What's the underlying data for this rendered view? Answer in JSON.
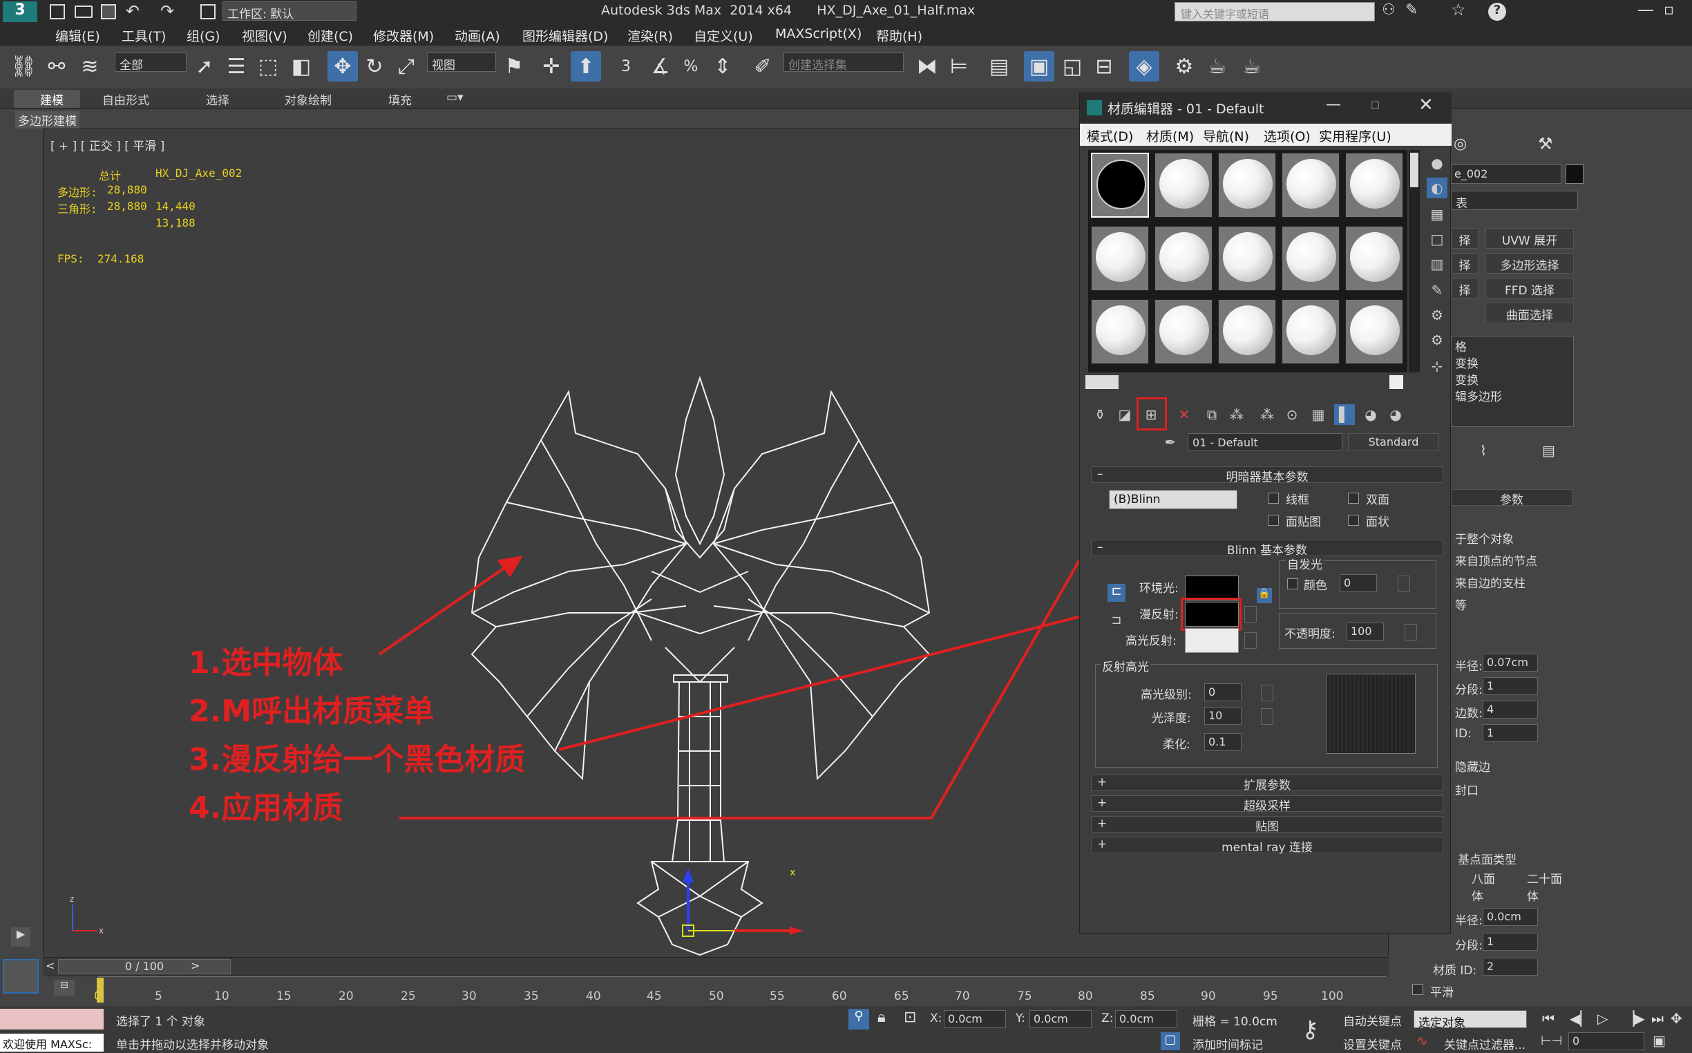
{
  "app": {
    "title": "Autodesk 3ds Max  2014 x64      HX_DJ_Axe_01_Half.max",
    "workspace_label": "工作区: 默认",
    "search_placeholder": "键入关键字或短语"
  },
  "menubar": [
    "编辑(E)",
    "工具(T)",
    "组(G)",
    "视图(V)",
    "创建(C)",
    "修改器(M)",
    "动画(A)",
    "图形编辑器(D)",
    "渲染(R)",
    "自定义(U)",
    "MAXScript(X)",
    "帮助(H)"
  ],
  "toolbar": {
    "selection_filter": "全部",
    "ref_coord": "视图",
    "named_selection": "创建选择集",
    "snap_labels": [
      "3",
      "%"
    ]
  },
  "ribbon": {
    "tabs": [
      "建模",
      "自由形式",
      "选择",
      "对象绘制",
      "填充"
    ],
    "subtab": "多边形建模"
  },
  "viewport": {
    "label": "[ + ] [ 正交 ] [ 平滑 ]",
    "stats": {
      "header_total": "总计",
      "header_object": "HX_DJ_Axe_002",
      "poly_label": "多边形:",
      "poly_total": "28,880",
      "poly_obj": "14,440",
      "tri_label": "三角形:",
      "tri_total": "28,880",
      "tri_obj": "13,188",
      "fps_label": "FPS:",
      "fps_value": "274.168"
    },
    "axis_labels": {
      "x": "x",
      "z": "z"
    }
  },
  "annotations": [
    "1.选中物体",
    "2.M呼出材质菜单",
    "3.漫反射给一个黑色材质",
    "4.应用材质"
  ],
  "material_editor": {
    "title": "材质编辑器 - 01 - Default",
    "menu": [
      "模式(D)",
      "材质(M)",
      "导航(N)",
      "选项(O)",
      "实用程序(U)"
    ],
    "material_name": "01 - Default",
    "material_type": "Standard",
    "shader_rollout": "明暗器基本参数",
    "shader": "(B)Blinn",
    "shader_options": [
      "线框",
      "双面",
      "面贴图",
      "面状"
    ],
    "blinn_rollout": "Blinn 基本参数",
    "self_illum_label": "自发光",
    "color_label": "颜色",
    "color_value": "0",
    "ambient_label": "环境光:",
    "diffuse_label": "漫反射:",
    "specular_label": "高光反射:",
    "opacity_label": "不透明度:",
    "opacity_value": "100",
    "spec_highlight_label": "反射高光",
    "spec_level_label": "高光级别:",
    "spec_level_value": "0",
    "gloss_label": "光泽度:",
    "gloss_value": "10",
    "soften_label": "柔化:",
    "soften_value": "0.1",
    "rollouts": [
      "扩展参数",
      "超级采样",
      "贴图",
      "mental ray 连接"
    ],
    "colors": {
      "ambient": "#000000",
      "diffuse": "#000000",
      "specular": "#ececec"
    }
  },
  "command_panel": {
    "object_name": "e_002",
    "list_label": "表",
    "buttons": [
      "UVW 展开",
      "多边形选择",
      "FFD 选择",
      "曲面选择"
    ],
    "button_stubs": [
      "择",
      "择",
      "择"
    ],
    "stack": [
      "格",
      "变换",
      "变换",
      "辑多边形"
    ],
    "params_rollout": "参数",
    "options": [
      "于整个对象",
      "来自顶点的节点",
      "来自边的支柱",
      "等"
    ],
    "radius_label": "半径:",
    "radius_value": "0.07cm",
    "segments_label": "分段:",
    "segments_value": "1",
    "sides_label": "边数:",
    "sides_value": "4",
    "matid_label": "ID:",
    "matid_value": "1",
    "hidden_edges": "隐藏边",
    "cap": "封口",
    "vertex_type_label": "基点面类型",
    "vertex_type_options": [
      "八面体",
      "二十面体"
    ],
    "v_radius_label": "半径:",
    "v_radius_value": "0.0cm",
    "v_segments_label": "分段:",
    "v_segments_value": "1",
    "v_matid_label": "材质 ID:",
    "v_matid_value": "2",
    "smooth_label": "平滑"
  },
  "timeline": {
    "frame": "0 / 100",
    "ticks": [
      "0",
      "5",
      "10",
      "15",
      "20",
      "25",
      "30",
      "35",
      "40",
      "45",
      "50",
      "55",
      "60",
      "65",
      "70",
      "75",
      "80",
      "85",
      "90",
      "95",
      "100"
    ]
  },
  "statusbar": {
    "welcome": "欢迎使用 MAXSc:",
    "selected": "选择了 1 个 对象",
    "hint": "单击并拖动以选择并移动对象",
    "x_label": "X:",
    "x_value": "0.0cm",
    "y_label": "Y:",
    "y_value": "0.0cm",
    "z_label": "Z:",
    "z_value": "0.0cm",
    "grid": "栅格 = 10.0cm",
    "add_time_tag": "添加时间标记",
    "auto_key": "自动关键点",
    "set_key": "设置关键点",
    "selected_object": "选定对象",
    "key_filter": "关键点过滤器...",
    "frame_value": "0"
  }
}
